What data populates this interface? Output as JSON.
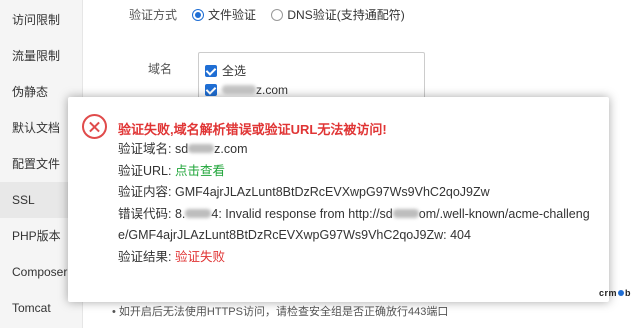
{
  "sidebar": {
    "items": [
      {
        "label": "访问限制"
      },
      {
        "label": "流量限制"
      },
      {
        "label": "伪静态"
      },
      {
        "label": "默认文档"
      },
      {
        "label": "配置文件"
      },
      {
        "label": "SSL"
      },
      {
        "label": "PHP版本"
      },
      {
        "label": "Composer"
      },
      {
        "label": "Tomcat"
      }
    ],
    "active": "SSL"
  },
  "form": {
    "verify_method_label": "验证方式",
    "option_file": "文件验证",
    "option_dns": "DNS验证(支持通配符)",
    "domain_label": "域名",
    "select_all": "全选",
    "domain_suffix": "z.com",
    "bottom_note": "如开启后无法使用HTTPS访问，请检查安全组是否正确放行443端口"
  },
  "dialog": {
    "title": "验证失败,域名解析错误或验证URL无法被访问!",
    "domain_label": "验证域名:",
    "domain_prefix": "sd",
    "domain_suffix": "z.com",
    "url_label": "验证URL:",
    "url_link": "点击查看",
    "content_label": "验证内容:",
    "content_value": "GMF4ajrJLAzLunt8BtDzRcEVXwpG97Ws9VhC2qoJ9Zw",
    "error_label": "错误代码:",
    "error_prefix": "8.",
    "error_mid": "4: Invalid response from http://sd",
    "error_rest": "om/.well-known/acme-challenge/GMF4ajrJLAzLunt8BtDzRcEVXwpG97Ws9VhC2qoJ9Zw: 404",
    "result_label": "验证结果:",
    "result_value": "验证失败"
  },
  "colors": {
    "error_red": "#e03535",
    "link_green": "#20a53a",
    "accent_blue": "#1f6ed4"
  }
}
